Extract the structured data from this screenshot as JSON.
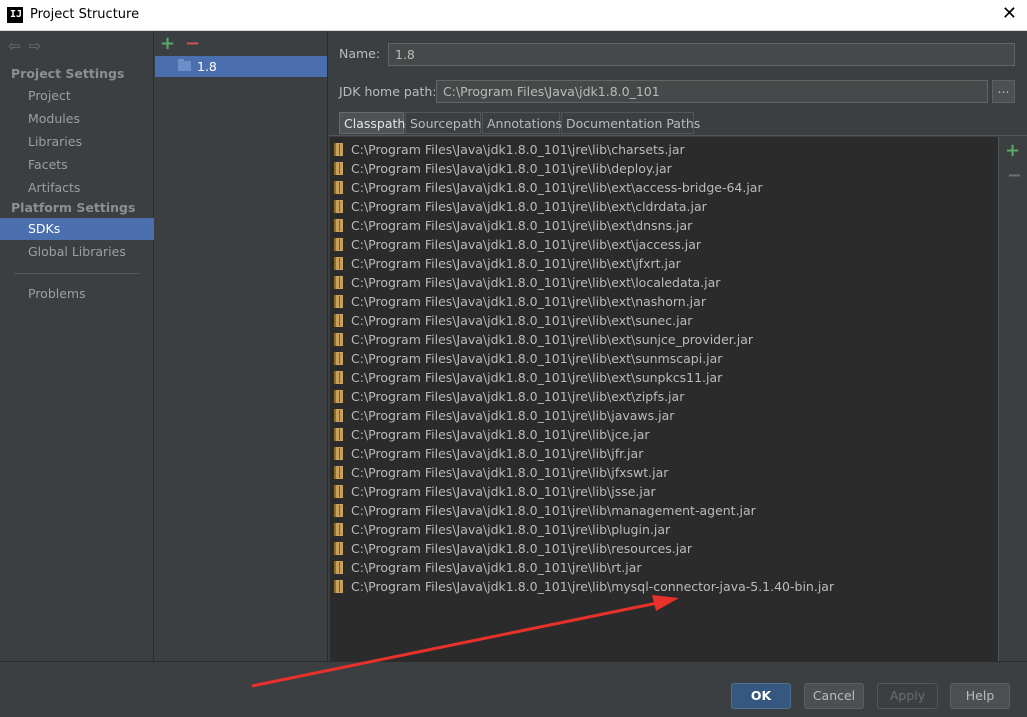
{
  "window": {
    "title": "Project Structure",
    "close_label": "✕"
  },
  "nav": {
    "back_icon": "⇦",
    "forward_icon": "⇨",
    "project_settings_title": "Project Settings",
    "project_settings": [
      "Project",
      "Modules",
      "Libraries",
      "Facets",
      "Artifacts"
    ],
    "platform_settings_title": "Platform Settings",
    "platform_settings": [
      "SDKs",
      "Global Libraries"
    ],
    "selected": "SDKs",
    "problems": "Problems"
  },
  "sdk_list": {
    "add_icon": "+",
    "remove_icon": "−",
    "items": [
      "1.8"
    ]
  },
  "form": {
    "name_label": "Name:",
    "name_value": "1.8",
    "home_label": "JDK home path:",
    "home_value": "C:\\Program Files\\Java\\jdk1.8.0_101",
    "browse_label": "..."
  },
  "tabs": [
    "Classpath",
    "Sourcepath",
    "Annotations",
    "Documentation Paths"
  ],
  "active_tab": "Classpath",
  "classpath": [
    "C:\\Program Files\\Java\\jdk1.8.0_101\\jre\\lib\\charsets.jar",
    "C:\\Program Files\\Java\\jdk1.8.0_101\\jre\\lib\\deploy.jar",
    "C:\\Program Files\\Java\\jdk1.8.0_101\\jre\\lib\\ext\\access-bridge-64.jar",
    "C:\\Program Files\\Java\\jdk1.8.0_101\\jre\\lib\\ext\\cldrdata.jar",
    "C:\\Program Files\\Java\\jdk1.8.0_101\\jre\\lib\\ext\\dnsns.jar",
    "C:\\Program Files\\Java\\jdk1.8.0_101\\jre\\lib\\ext\\jaccess.jar",
    "C:\\Program Files\\Java\\jdk1.8.0_101\\jre\\lib\\ext\\jfxrt.jar",
    "C:\\Program Files\\Java\\jdk1.8.0_101\\jre\\lib\\ext\\localedata.jar",
    "C:\\Program Files\\Java\\jdk1.8.0_101\\jre\\lib\\ext\\nashorn.jar",
    "C:\\Program Files\\Java\\jdk1.8.0_101\\jre\\lib\\ext\\sunec.jar",
    "C:\\Program Files\\Java\\jdk1.8.0_101\\jre\\lib\\ext\\sunjce_provider.jar",
    "C:\\Program Files\\Java\\jdk1.8.0_101\\jre\\lib\\ext\\sunmscapi.jar",
    "C:\\Program Files\\Java\\jdk1.8.0_101\\jre\\lib\\ext\\sunpkcs11.jar",
    "C:\\Program Files\\Java\\jdk1.8.0_101\\jre\\lib\\ext\\zipfs.jar",
    "C:\\Program Files\\Java\\jdk1.8.0_101\\jre\\lib\\javaws.jar",
    "C:\\Program Files\\Java\\jdk1.8.0_101\\jre\\lib\\jce.jar",
    "C:\\Program Files\\Java\\jdk1.8.0_101\\jre\\lib\\jfr.jar",
    "C:\\Program Files\\Java\\jdk1.8.0_101\\jre\\lib\\jfxswt.jar",
    "C:\\Program Files\\Java\\jdk1.8.0_101\\jre\\lib\\jsse.jar",
    "C:\\Program Files\\Java\\jdk1.8.0_101\\jre\\lib\\management-agent.jar",
    "C:\\Program Files\\Java\\jdk1.8.0_101\\jre\\lib\\plugin.jar",
    "C:\\Program Files\\Java\\jdk1.8.0_101\\jre\\lib\\resources.jar",
    "C:\\Program Files\\Java\\jdk1.8.0_101\\jre\\lib\\rt.jar",
    "C:\\Program Files\\Java\\jdk1.8.0_101\\jre\\lib\\mysql-connector-java-5.1.40-bin.jar"
  ],
  "classpath_side": {
    "add_icon": "+",
    "remove_icon": "−"
  },
  "buttons": {
    "ok": "OK",
    "cancel": "Cancel",
    "apply": "Apply",
    "help": "Help"
  },
  "colors": {
    "accent": "#4b6eaf",
    "annotation_arrow": "#e8312a",
    "background": "#3c3f41",
    "list_bg": "#2b2b2b"
  }
}
